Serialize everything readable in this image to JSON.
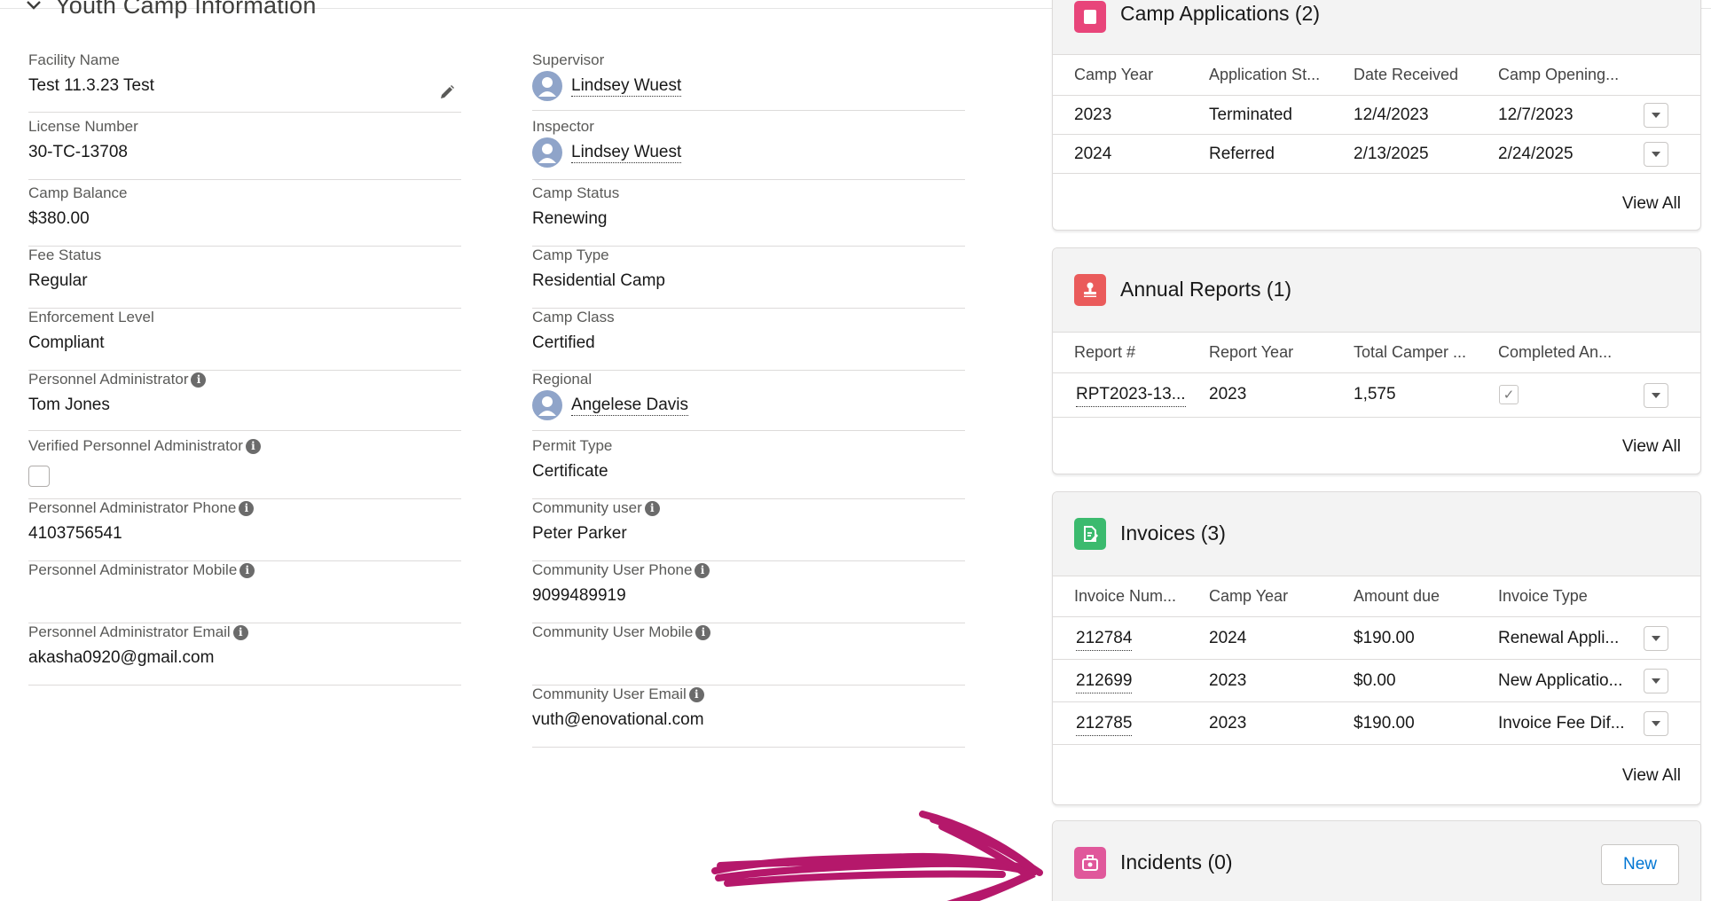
{
  "section": {
    "title": "Youth Camp Information"
  },
  "left_fields": [
    {
      "label": "Facility Name",
      "value": "Test 11.3.23 Test"
    },
    {
      "label": "License Number",
      "value": "30-TC-13708"
    },
    {
      "label": "Camp Balance",
      "value": "$380.00"
    },
    {
      "label": "Fee Status",
      "value": "Regular"
    },
    {
      "label": "Enforcement Level",
      "value": "Compliant"
    },
    {
      "label": "Personnel Administrator",
      "value": "Tom Jones"
    },
    {
      "label": "Verified Personnel Administrator",
      "value": ""
    },
    {
      "label": "Personnel Administrator Phone",
      "value": "4103756541"
    },
    {
      "label": "Personnel Administrator Mobile",
      "value": ""
    },
    {
      "label": "Personnel Administrator Email",
      "value": "akasha0920@gmail.com"
    }
  ],
  "right_fields": [
    {
      "label": "Supervisor",
      "value": "Lindsey Wuest"
    },
    {
      "label": "Inspector",
      "value": "Lindsey Wuest"
    },
    {
      "label": "Camp Status",
      "value": "Renewing"
    },
    {
      "label": "Camp Type",
      "value": "Residential Camp"
    },
    {
      "label": "Camp Class",
      "value": "Certified"
    },
    {
      "label": "Regional",
      "value": "Angelese Davis"
    },
    {
      "label": "Permit Type",
      "value": "Certificate"
    },
    {
      "label": "Community user",
      "value": "Peter Parker"
    },
    {
      "label": "Community User Phone",
      "value": "9099489919"
    },
    {
      "label": "Community User Mobile",
      "value": ""
    },
    {
      "label": "Community User Email",
      "value": "vuth@enovational.com"
    }
  ],
  "camp_applications": {
    "title": "Camp Applications (2)",
    "columns": [
      "Camp Year",
      "Application St...",
      "Date Received",
      "Camp Opening..."
    ],
    "rows": [
      [
        "2023",
        "Terminated",
        "12/4/2023",
        "12/7/2023"
      ],
      [
        "2024",
        "Referred",
        "2/13/2025",
        "2/24/2025"
      ]
    ],
    "view_all": "View All",
    "icon": "application-icon",
    "color": "#e8457a"
  },
  "annual_reports": {
    "title": "Annual Reports (1)",
    "columns": [
      "Report #",
      "Report Year",
      "Total Camper ...",
      "Completed An..."
    ],
    "rows": [
      [
        "RPT2023-13...",
        "2023",
        "1,575",
        "✓"
      ]
    ],
    "view_all": "View All",
    "icon": "stamp-icon",
    "color": "#ea5b5b"
  },
  "invoices": {
    "title": "Invoices (3)",
    "columns": [
      "Invoice Num...",
      "Camp Year",
      "Amount due",
      "Invoice Type"
    ],
    "rows": [
      [
        "212784",
        "2024",
        "$190.00",
        "Renewal Appli..."
      ],
      [
        "212699",
        "2023",
        "$0.00",
        "New Applicatio..."
      ],
      [
        "212785",
        "2023",
        "$190.00",
        "Invoice Fee Dif..."
      ]
    ],
    "view_all": "View All",
    "icon": "invoice-icon",
    "color": "#3bba6e"
  },
  "incidents": {
    "title": "Incidents (0)",
    "new_label": "New",
    "icon": "incident-icon",
    "color": "#e0589b"
  },
  "annotation": {
    "arrow_color": "#b5186b"
  }
}
